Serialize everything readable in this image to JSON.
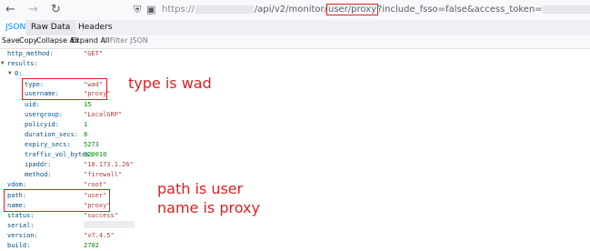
{
  "url": {
    "scheme": "https://",
    "path_part": "/api/v2/monitor/",
    "highlight": "user/proxy",
    "query": "?include_fsso=false&access_token="
  },
  "tabs": [
    {
      "label": "JSON"
    },
    {
      "label": "Raw Data"
    },
    {
      "label": "Headers"
    }
  ],
  "toolbar": {
    "save": "Save",
    "copy": "Copy",
    "collapse_all": "Collapse All",
    "expand_all": "Expand All",
    "filter": "Filter JSON"
  },
  "json": {
    "http_method": {
      "key": "http_method:",
      "value": "\"GET\""
    },
    "results": {
      "key": "results:"
    },
    "idx0": {
      "key": "0:"
    },
    "type": {
      "key": "type:",
      "value": "\"wad\""
    },
    "username": {
      "key": "username:",
      "value": "\"proxy\""
    },
    "uid": {
      "key": "uid:",
      "value": "15"
    },
    "usergroup": {
      "key": "usergroup:",
      "value": "\"LocalGRP\""
    },
    "policyid": {
      "key": "policyid:",
      "value": "1"
    },
    "duration_secs": {
      "key": "duration_secs:",
      "value": "8"
    },
    "expiry_secs": {
      "key": "expiry_secs:",
      "value": "5273"
    },
    "traffic_vol_bytes": {
      "key": "traffic_vol_bytes:",
      "value": "320010"
    },
    "ipaddr": {
      "key": "ipaddr:",
      "value": "\"10.173.1.26\""
    },
    "method": {
      "key": "method:",
      "value": "\"firewall\""
    },
    "vdom": {
      "key": "vdom:",
      "value": "\"root\""
    },
    "path": {
      "key": "path:",
      "value": "\"user\""
    },
    "name": {
      "key": "name:",
      "value": "\"proxy\""
    },
    "status": {
      "key": "status:",
      "value": "\"success\""
    },
    "serial": {
      "key": "serial:"
    },
    "version": {
      "key": "version:",
      "value": "\"v7.4.5\""
    },
    "build": {
      "key": "build:",
      "value": "2702"
    }
  },
  "annotations": {
    "type_note": "type is wad",
    "path_note": "path is user",
    "name_note": "name is proxy"
  },
  "colors": {
    "annotation": "#e02020",
    "string": "#ad3f40",
    "number": "#058b00",
    "key": "#00508c",
    "active_tab": "#0a84ff"
  },
  "icons": [
    "back-arrow-icon",
    "forward-arrow-icon",
    "reload-icon",
    "shield-icon",
    "lock-icon",
    "filter-icon",
    "expand-triangle-icon"
  ]
}
